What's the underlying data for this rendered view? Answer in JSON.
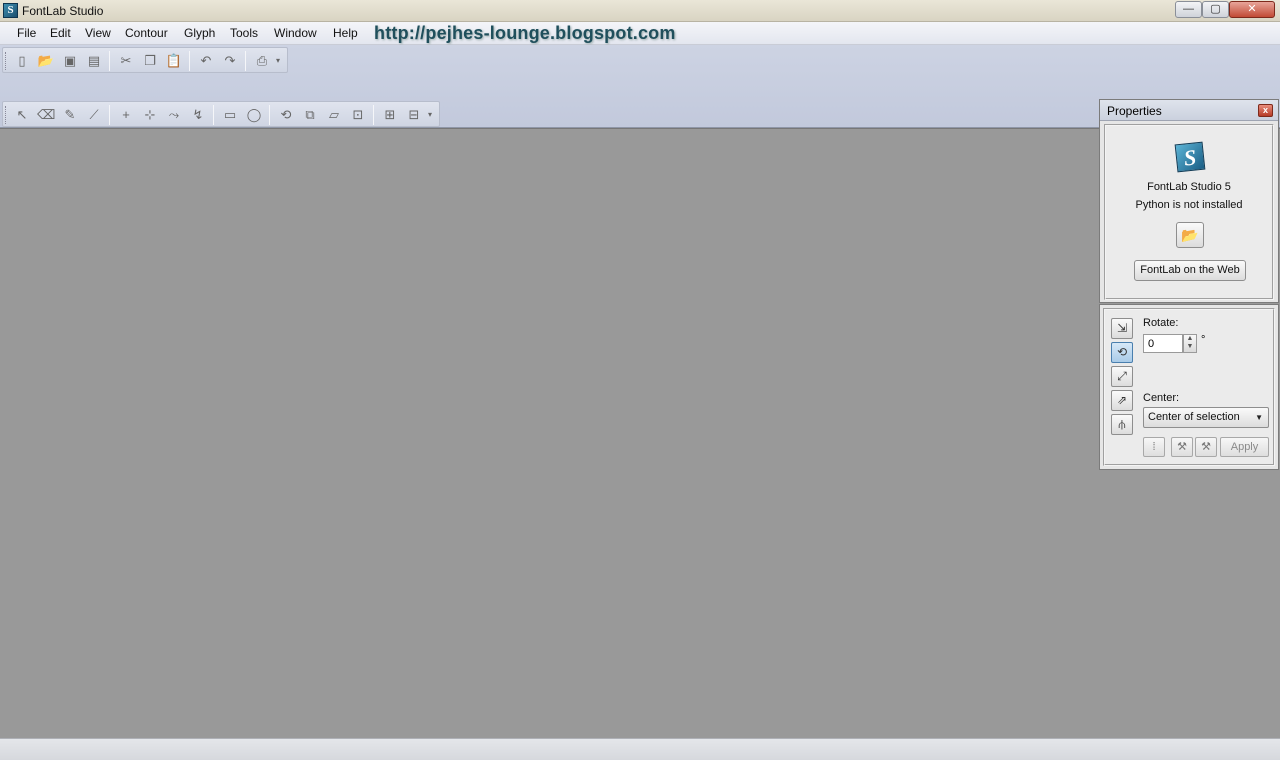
{
  "window": {
    "title": "FontLab Studio",
    "min_glyph": "—",
    "max_glyph": "▢",
    "close_glyph": "✕"
  },
  "menu": [
    "File",
    "Edit",
    "View",
    "Contour",
    "Glyph",
    "Tools",
    "Window",
    "Help"
  ],
  "watermark": "http://pejhes-lounge.blogspot.com",
  "toolbar_std": [
    {
      "icon": "new-file-icon",
      "glyph": "▯"
    },
    {
      "icon": "open-folder-icon",
      "glyph": "📂"
    },
    {
      "icon": "save-icon",
      "glyph": "▣"
    },
    {
      "icon": "save-all-icon",
      "glyph": "▤"
    },
    {
      "icon": "cut-icon",
      "glyph": "✂"
    },
    {
      "icon": "copy-icon",
      "glyph": "❐"
    },
    {
      "icon": "paste-icon",
      "glyph": "📋"
    },
    {
      "icon": "undo-icon",
      "glyph": "↶"
    },
    {
      "icon": "redo-icon",
      "glyph": "↷"
    },
    {
      "icon": "print-icon",
      "glyph": "⎙"
    }
  ],
  "toolbar_tools": [
    {
      "icon": "pointer-icon",
      "glyph": "↖"
    },
    {
      "icon": "eraser-icon",
      "glyph": "⌫"
    },
    {
      "icon": "pencil-icon",
      "glyph": "✎"
    },
    {
      "icon": "knife-icon",
      "glyph": "⟋"
    },
    {
      "icon": "add-node-icon",
      "glyph": "+"
    },
    {
      "icon": "add-corner-icon",
      "glyph": "⊹"
    },
    {
      "icon": "add-curve-icon",
      "glyph": "⤳"
    },
    {
      "icon": "add-tangent-icon",
      "glyph": "↯"
    },
    {
      "icon": "rectangle-icon",
      "glyph": "▭"
    },
    {
      "icon": "ellipse-icon",
      "glyph": "◯"
    },
    {
      "icon": "rotate-icon",
      "glyph": "⟲"
    },
    {
      "icon": "scale-icon",
      "glyph": "⧉"
    },
    {
      "icon": "slant-icon",
      "glyph": "▱"
    },
    {
      "icon": "transform-icon",
      "glyph": "⊡"
    },
    {
      "icon": "measure-icon",
      "glyph": "⊞"
    },
    {
      "icon": "guides-icon",
      "glyph": "⊟"
    }
  ],
  "properties": {
    "title": "Properties",
    "close_glyph": "x",
    "logo_letter": "S",
    "product": "FontLab Studio 5",
    "python_status": "Python is not installed",
    "open_glyph": "📂",
    "web_button": "FontLab on the Web"
  },
  "transform": {
    "side_buttons": [
      {
        "icon": "move-icon",
        "glyph": "⇲",
        "active": false
      },
      {
        "icon": "rotate-tool-icon",
        "glyph": "⟲",
        "active": true
      },
      {
        "icon": "scale-tool-icon",
        "glyph": "⤢",
        "active": false
      },
      {
        "icon": "slant-tool-icon",
        "glyph": "⇗",
        "active": false
      },
      {
        "icon": "mirror-tool-icon",
        "glyph": "⫛",
        "active": false
      }
    ],
    "rotate_label": "Rotate:",
    "rotate_value": "0",
    "degree_symbol": "°",
    "center_label": "Center:",
    "center_value": "Center of selection",
    "action_buttons": [
      {
        "icon": "dotted-icon",
        "glyph": "⁞"
      },
      {
        "icon": "hammer-icon",
        "glyph": "⚒"
      },
      {
        "icon": "hammer-multi-icon",
        "glyph": "⚒"
      }
    ],
    "apply_label": "Apply"
  }
}
